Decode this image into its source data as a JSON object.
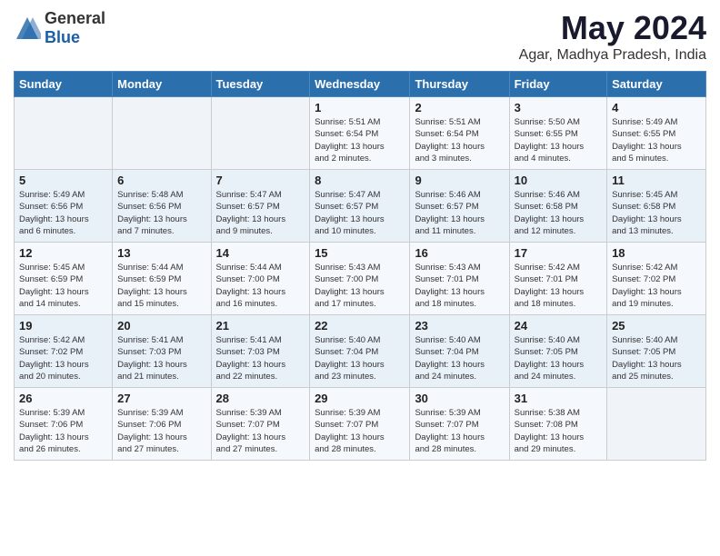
{
  "logo": {
    "general": "General",
    "blue": "Blue"
  },
  "header": {
    "month": "May 2024",
    "location": "Agar, Madhya Pradesh, India"
  },
  "weekdays": [
    "Sunday",
    "Monday",
    "Tuesday",
    "Wednesday",
    "Thursday",
    "Friday",
    "Saturday"
  ],
  "weeks": [
    [
      {
        "day": "",
        "info": ""
      },
      {
        "day": "",
        "info": ""
      },
      {
        "day": "",
        "info": ""
      },
      {
        "day": "1",
        "info": "Sunrise: 5:51 AM\nSunset: 6:54 PM\nDaylight: 13 hours\nand 2 minutes."
      },
      {
        "day": "2",
        "info": "Sunrise: 5:51 AM\nSunset: 6:54 PM\nDaylight: 13 hours\nand 3 minutes."
      },
      {
        "day": "3",
        "info": "Sunrise: 5:50 AM\nSunset: 6:55 PM\nDaylight: 13 hours\nand 4 minutes."
      },
      {
        "day": "4",
        "info": "Sunrise: 5:49 AM\nSunset: 6:55 PM\nDaylight: 13 hours\nand 5 minutes."
      }
    ],
    [
      {
        "day": "5",
        "info": "Sunrise: 5:49 AM\nSunset: 6:56 PM\nDaylight: 13 hours\nand 6 minutes."
      },
      {
        "day": "6",
        "info": "Sunrise: 5:48 AM\nSunset: 6:56 PM\nDaylight: 13 hours\nand 7 minutes."
      },
      {
        "day": "7",
        "info": "Sunrise: 5:47 AM\nSunset: 6:57 PM\nDaylight: 13 hours\nand 9 minutes."
      },
      {
        "day": "8",
        "info": "Sunrise: 5:47 AM\nSunset: 6:57 PM\nDaylight: 13 hours\nand 10 minutes."
      },
      {
        "day": "9",
        "info": "Sunrise: 5:46 AM\nSunset: 6:57 PM\nDaylight: 13 hours\nand 11 minutes."
      },
      {
        "day": "10",
        "info": "Sunrise: 5:46 AM\nSunset: 6:58 PM\nDaylight: 13 hours\nand 12 minutes."
      },
      {
        "day": "11",
        "info": "Sunrise: 5:45 AM\nSunset: 6:58 PM\nDaylight: 13 hours\nand 13 minutes."
      }
    ],
    [
      {
        "day": "12",
        "info": "Sunrise: 5:45 AM\nSunset: 6:59 PM\nDaylight: 13 hours\nand 14 minutes."
      },
      {
        "day": "13",
        "info": "Sunrise: 5:44 AM\nSunset: 6:59 PM\nDaylight: 13 hours\nand 15 minutes."
      },
      {
        "day": "14",
        "info": "Sunrise: 5:44 AM\nSunset: 7:00 PM\nDaylight: 13 hours\nand 16 minutes."
      },
      {
        "day": "15",
        "info": "Sunrise: 5:43 AM\nSunset: 7:00 PM\nDaylight: 13 hours\nand 17 minutes."
      },
      {
        "day": "16",
        "info": "Sunrise: 5:43 AM\nSunset: 7:01 PM\nDaylight: 13 hours\nand 18 minutes."
      },
      {
        "day": "17",
        "info": "Sunrise: 5:42 AM\nSunset: 7:01 PM\nDaylight: 13 hours\nand 18 minutes."
      },
      {
        "day": "18",
        "info": "Sunrise: 5:42 AM\nSunset: 7:02 PM\nDaylight: 13 hours\nand 19 minutes."
      }
    ],
    [
      {
        "day": "19",
        "info": "Sunrise: 5:42 AM\nSunset: 7:02 PM\nDaylight: 13 hours\nand 20 minutes."
      },
      {
        "day": "20",
        "info": "Sunrise: 5:41 AM\nSunset: 7:03 PM\nDaylight: 13 hours\nand 21 minutes."
      },
      {
        "day": "21",
        "info": "Sunrise: 5:41 AM\nSunset: 7:03 PM\nDaylight: 13 hours\nand 22 minutes."
      },
      {
        "day": "22",
        "info": "Sunrise: 5:40 AM\nSunset: 7:04 PM\nDaylight: 13 hours\nand 23 minutes."
      },
      {
        "day": "23",
        "info": "Sunrise: 5:40 AM\nSunset: 7:04 PM\nDaylight: 13 hours\nand 24 minutes."
      },
      {
        "day": "24",
        "info": "Sunrise: 5:40 AM\nSunset: 7:05 PM\nDaylight: 13 hours\nand 24 minutes."
      },
      {
        "day": "25",
        "info": "Sunrise: 5:40 AM\nSunset: 7:05 PM\nDaylight: 13 hours\nand 25 minutes."
      }
    ],
    [
      {
        "day": "26",
        "info": "Sunrise: 5:39 AM\nSunset: 7:06 PM\nDaylight: 13 hours\nand 26 minutes."
      },
      {
        "day": "27",
        "info": "Sunrise: 5:39 AM\nSunset: 7:06 PM\nDaylight: 13 hours\nand 27 minutes."
      },
      {
        "day": "28",
        "info": "Sunrise: 5:39 AM\nSunset: 7:07 PM\nDaylight: 13 hours\nand 27 minutes."
      },
      {
        "day": "29",
        "info": "Sunrise: 5:39 AM\nSunset: 7:07 PM\nDaylight: 13 hours\nand 28 minutes."
      },
      {
        "day": "30",
        "info": "Sunrise: 5:39 AM\nSunset: 7:07 PM\nDaylight: 13 hours\nand 28 minutes."
      },
      {
        "day": "31",
        "info": "Sunrise: 5:38 AM\nSunset: 7:08 PM\nDaylight: 13 hours\nand 29 minutes."
      },
      {
        "day": "",
        "info": ""
      }
    ]
  ]
}
